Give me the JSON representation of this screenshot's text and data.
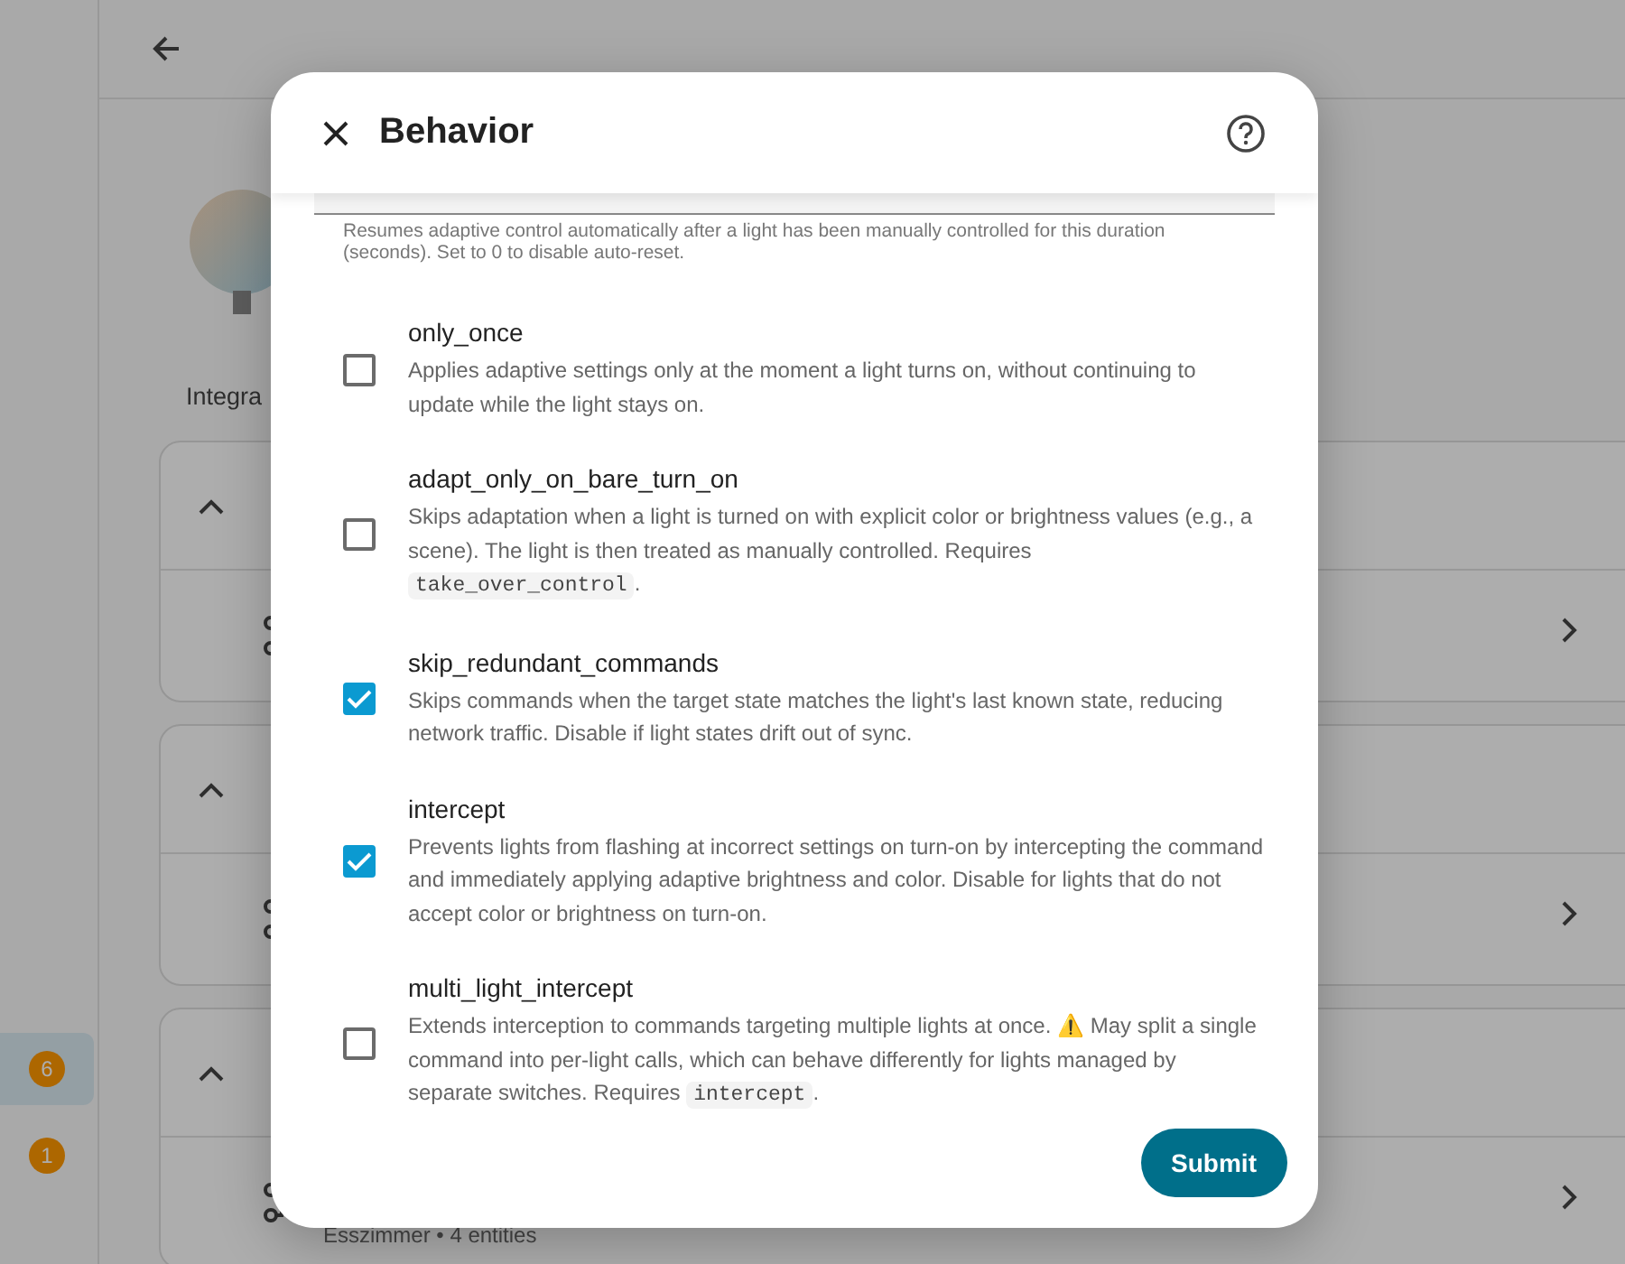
{
  "sidebar": {
    "items": [
      {
        "badge": "6",
        "selected": true
      },
      {
        "badge": "1",
        "selected": false
      }
    ]
  },
  "page": {
    "section_label": "Integra",
    "cards": [
      {
        "expanded": true
      },
      {
        "expanded": true
      },
      {
        "expanded": true,
        "row_subtitle": "Esszimmer • 4 entities"
      }
    ]
  },
  "dialog": {
    "title": "Behavior",
    "field_helper": "Resumes adaptive control automatically after a light has been manually controlled for this duration (seconds). Set to 0 to disable auto-reset.",
    "options": [
      {
        "name": "only_once",
        "checked": false,
        "description": [
          {
            "kind": "text",
            "text": "Applies adaptive settings only at the moment a light turns on, without continuing to update while the light stays on."
          }
        ]
      },
      {
        "name": "adapt_only_on_bare_turn_on",
        "checked": false,
        "description": [
          {
            "kind": "text",
            "text": "Skips adaptation when a light is turned on with explicit color or brightness values (e.g., a scene). The light is then treated as manually controlled. Requires "
          },
          {
            "kind": "code",
            "text": "take_over_control"
          },
          {
            "kind": "text",
            "text": "."
          }
        ]
      },
      {
        "name": "skip_redundant_commands",
        "checked": true,
        "description": [
          {
            "kind": "text",
            "text": "Skips commands when the target state matches the light's last known state, reducing network traffic. Disable if light states drift out of sync."
          }
        ]
      },
      {
        "name": "intercept",
        "checked": true,
        "description": [
          {
            "kind": "text",
            "text": "Prevents lights from flashing at incorrect settings on turn-on by intercepting the command and immediately applying adaptive brightness and color. Disable for lights that do not accept color or brightness on turn-on."
          }
        ]
      },
      {
        "name": "multi_light_intercept",
        "checked": false,
        "description": [
          {
            "kind": "text",
            "text": "Extends interception to commands targeting multiple lights at once. ⚠️ May split a single command into per-light calls, which can behave differently for lights managed by separate switches. Requires "
          },
          {
            "kind": "code",
            "text": "intercept"
          },
          {
            "kind": "text",
            "text": "."
          }
        ]
      }
    ],
    "submit": "Submit"
  }
}
